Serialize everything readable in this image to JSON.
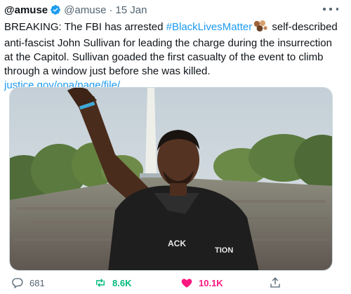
{
  "tweet": {
    "display_name": "@amuse",
    "handle": "@amuse",
    "separator": "·",
    "date": "15 Jan",
    "text_before_hashtag": "BREAKING: The FBI has arrested ",
    "hashtag": "#BlackLivesMatter",
    "text_after_hashtag": " self-described anti-fascist John Sullivan for leading the charge during the insurrection at the Capitol. Sullivan goaded the first casualty of the event to climb through a window just before she was killed.",
    "link": "justice.gov/opa/page/file/...",
    "image_overlay_text": {
      "shirt_left": "ACK",
      "shirt_right": "TION"
    }
  },
  "actions": {
    "replies": "681",
    "retweets": "8.6K",
    "likes": "10.1K"
  },
  "icons": {
    "verified": "verified-badge-icon",
    "more": "more-horizontal-icon",
    "hashtag_emoji": "raised-fist-skin-tones-emoji",
    "reply": "reply-icon",
    "retweet": "retweet-icon",
    "like": "heart-filled-icon",
    "share": "share-icon"
  },
  "colors": {
    "accent": "#1d9bf0",
    "retweet": "#00ba7c",
    "like": "#f91880",
    "muted": "#536471"
  }
}
